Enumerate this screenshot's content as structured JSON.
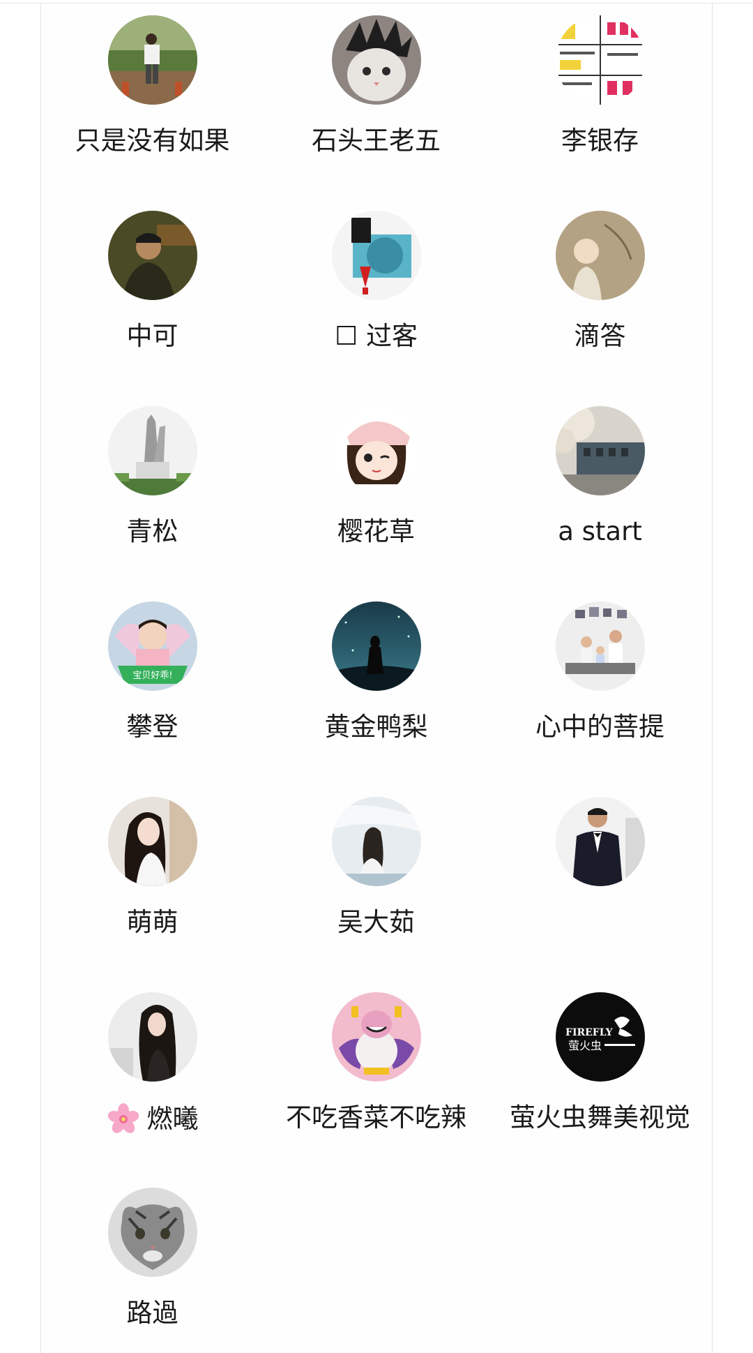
{
  "members": [
    {
      "name": "只是没有如果",
      "avatar_icon": "man-standing-photo-icon"
    },
    {
      "name": "石头王老五",
      "avatar_icon": "cat-wig-photo-icon"
    },
    {
      "name": "李银存",
      "avatar_icon": "comic-panels-icon"
    },
    {
      "name": "中可",
      "avatar_icon": "man-portrait-photo-icon"
    },
    {
      "name": "☐ 过客",
      "avatar_icon": "poster-graphic-icon"
    },
    {
      "name": "滴答",
      "avatar_icon": "baby-monk-photo-icon"
    },
    {
      "name": "青松",
      "avatar_icon": "statue-photo-icon"
    },
    {
      "name": "樱花草",
      "avatar_icon": "cartoon-girl-icon"
    },
    {
      "name": "a start",
      "avatar_icon": "train-blossom-photo-icon"
    },
    {
      "name": "攀登",
      "avatar_icon": "baby-photo-icon"
    },
    {
      "name": "黄金鸭梨",
      "avatar_icon": "night-sky-silhouette-icon"
    },
    {
      "name": "心中的菩提",
      "avatar_icon": "family-photo-icon"
    },
    {
      "name": "萌萌",
      "avatar_icon": "girl-portrait-photo-icon"
    },
    {
      "name": "吴大茹",
      "avatar_icon": "woman-sky-photo-icon"
    },
    {
      "name": "",
      "avatar_icon": "man-tuxedo-photo-icon"
    },
    {
      "name": "燃曦",
      "name_prefix_icon": "cherry-blossom-icon",
      "avatar_icon": "woman-long-hair-photo-icon"
    },
    {
      "name": "不吃香菜不吃辣",
      "avatar_icon": "cartoon-character-icon"
    },
    {
      "name": "萤火虫舞美视觉",
      "avatar_icon": "firefly-logo-icon"
    },
    {
      "name": "路過",
      "avatar_icon": "tabby-cat-photo-icon"
    }
  ],
  "colors": {
    "background": "#ffffff",
    "name_text": "#1a1a1a",
    "frame_border": "#e2e2e2"
  }
}
